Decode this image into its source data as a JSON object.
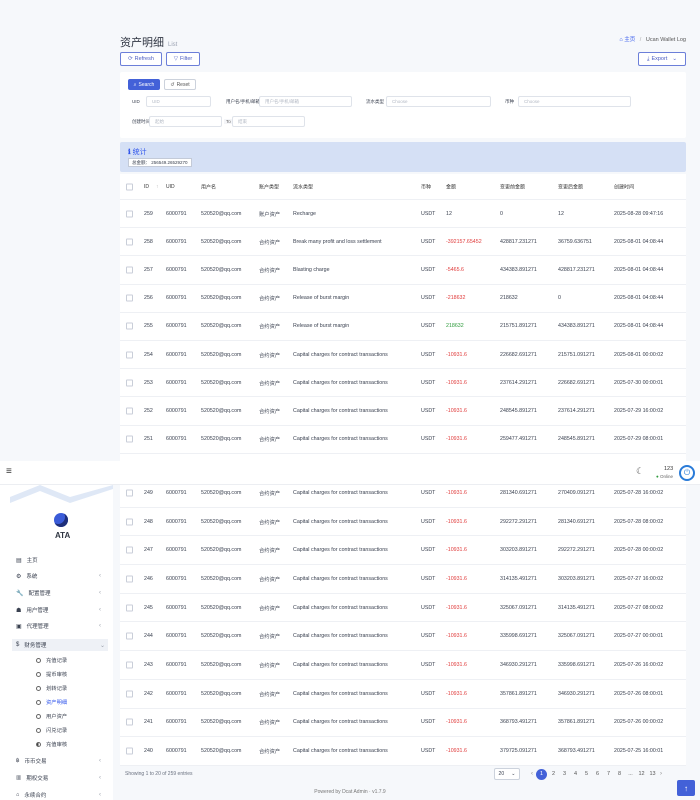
{
  "header": {
    "title": "资产明细",
    "subtitle": "List",
    "crumb_home": "主页",
    "crumb_sep": "/",
    "crumb_current": "Ucan Wallet Log"
  },
  "toolbar": {
    "refresh": "Refresh",
    "filter": "Filter",
    "export": "Export"
  },
  "search": {
    "search_btn": "Search",
    "reset_btn": "Reset",
    "uid_label": "UID",
    "uid_placeholder": "UID",
    "account_label": "用户名/手机/邮箱",
    "account_placeholder": "用户名/手机/邮箱",
    "type_label": "流水类型",
    "type_placeholder": "Choose",
    "coin_label": "币种",
    "coin_placeholder": "Choose",
    "time_label": "创建时间",
    "time_from": "起始",
    "time_to_label": "To",
    "time_to": "结束"
  },
  "stats": {
    "title": "统计",
    "total": "总金额： 256549.26529270"
  },
  "table": {
    "headers": [
      "ID",
      "UID",
      "用户名",
      "账户类型",
      "流水类型",
      "币种",
      "金额",
      "变更前金额",
      "变更后金额",
      "创建时间"
    ],
    "rows": [
      [
        "259",
        "6000791",
        "520520@qq.com",
        "账户资产",
        "Recharge",
        "USDT",
        "12",
        "0",
        "12",
        "2025-08-28 09:47:16"
      ],
      [
        "258",
        "6000791",
        "520520@qq.com",
        "合约资产",
        "Break many profit and loss settlement",
        "USDT",
        "-392157.65452",
        "428817.231271",
        "36759.636751",
        "2025-08-01 04:08:44"
      ],
      [
        "257",
        "6000791",
        "520520@qq.com",
        "合约资产",
        "Blasting charge",
        "USDT",
        "-5465.6",
        "434383.891271",
        "428817.231271",
        "2025-08-01 04:08:44"
      ],
      [
        "256",
        "6000791",
        "520520@qq.com",
        "合约资产",
        "Release of burst margin",
        "USDT",
        "-218632",
        "218632",
        "0",
        "2025-08-01 04:08:44"
      ],
      [
        "255",
        "6000791",
        "520520@qq.com",
        "合约资产",
        "Release of burst margin",
        "USDT",
        "218632",
        "215751.891271",
        "434383.891271",
        "2025-08-01 04:08:44"
      ],
      [
        "254",
        "6000791",
        "520520@qq.com",
        "合约资产",
        "Capital charges for contract transactions",
        "USDT",
        "-10931.6",
        "226682.691271",
        "215751.091271",
        "2025-08-01 00:00:02"
      ],
      [
        "253",
        "6000791",
        "520520@qq.com",
        "合约资产",
        "Capital charges for contract transactions",
        "USDT",
        "-10931.6",
        "237614.291271",
        "226682.691271",
        "2025-07-30 00:00:01"
      ],
      [
        "252",
        "6000791",
        "520520@qq.com",
        "合约资产",
        "Capital charges for contract transactions",
        "USDT",
        "-10931.6",
        "248545.891271",
        "237614.291271",
        "2025-07-29 16:00:02"
      ],
      [
        "251",
        "6000791",
        "520520@qq.com",
        "合约资产",
        "Capital charges for contract transactions",
        "USDT",
        "-10931.6",
        "259477.491271",
        "248545.891271",
        "2025-07-29 08:00:01"
      ],
      [
        "249",
        "6000791",
        "520520@qq.com",
        "合约资产",
        "Capital charges for contract transactions",
        "USDT",
        "-10931.6",
        "281340.691271",
        "270409.091271",
        "2025-07-28 16:00:02"
      ],
      [
        "248",
        "6000791",
        "520520@qq.com",
        "合约资产",
        "Capital charges for contract transactions",
        "USDT",
        "-10931.6",
        "292272.291271",
        "281340.691271",
        "2025-07-28 08:00:02"
      ],
      [
        "247",
        "6000791",
        "520520@qq.com",
        "合约资产",
        "Capital charges for contract transactions",
        "USDT",
        "-10931.6",
        "303203.891271",
        "292272.291271",
        "2025-07-28 00:00:02"
      ],
      [
        "246",
        "6000791",
        "520520@qq.com",
        "合约资产",
        "Capital charges for contract transactions",
        "USDT",
        "-10931.6",
        "314135.491271",
        "303203.891271",
        "2025-07-27 16:00:02"
      ],
      [
        "245",
        "6000791",
        "520520@qq.com",
        "合约资产",
        "Capital charges for contract transactions",
        "USDT",
        "-10931.6",
        "325067.091271",
        "314135.491271",
        "2025-07-27 08:00:02"
      ],
      [
        "244",
        "6000791",
        "520520@qq.com",
        "合约资产",
        "Capital charges for contract transactions",
        "USDT",
        "-10931.6",
        "335998.691271",
        "325067.091271",
        "2025-07-27 00:00:01"
      ],
      [
        "243",
        "6000791",
        "520520@qq.com",
        "合约资产",
        "Capital charges for contract transactions",
        "USDT",
        "-10931.6",
        "346930.291271",
        "335998.691271",
        "2025-07-26 16:00:02"
      ],
      [
        "242",
        "6000791",
        "520520@qq.com",
        "合约资产",
        "Capital charges for contract transactions",
        "USDT",
        "-10931.6",
        "357861.891271",
        "346930.291271",
        "2025-07-26 08:00:01"
      ],
      [
        "241",
        "6000791",
        "520520@qq.com",
        "合约资产",
        "Capital charges for contract transactions",
        "USDT",
        "-10931.6",
        "368793.491271",
        "357861.891271",
        "2025-07-26 00:00:02"
      ],
      [
        "240",
        "6000791",
        "520520@qq.com",
        "合约资产",
        "Capital charges for contract transactions",
        "USDT",
        "-10931.6",
        "379725.091271",
        "368793.491271",
        "2025-07-25 16:00:01"
      ]
    ]
  },
  "footer": {
    "showing": "Showing 1 to 20 of 259 entries",
    "per_page": "20",
    "pages": [
      "1",
      "2",
      "3",
      "4",
      "5",
      "6",
      "7",
      "8",
      "...",
      "12",
      "13"
    ],
    "powered": "Powered by Dcat Admin · v1.7.9"
  },
  "topbar": {
    "user_count": "123",
    "user_status": "Online"
  },
  "sidebar": {
    "brand": "ATA",
    "items": [
      "主页",
      "系统",
      "配置管理",
      "用户管理",
      "代理管理",
      "财务管理"
    ],
    "sub_items": [
      "充值记录",
      "提币审核",
      "划转记录",
      "资产明细",
      "用户资产",
      "闪兑记录",
      "充值审核"
    ],
    "bottom_items": [
      "币币交易",
      "期权交易",
      "永续合约"
    ]
  },
  "colors": {
    "accent": "#4361d8",
    "negative": "#e03b3b",
    "positive": "#2e9b3c"
  }
}
